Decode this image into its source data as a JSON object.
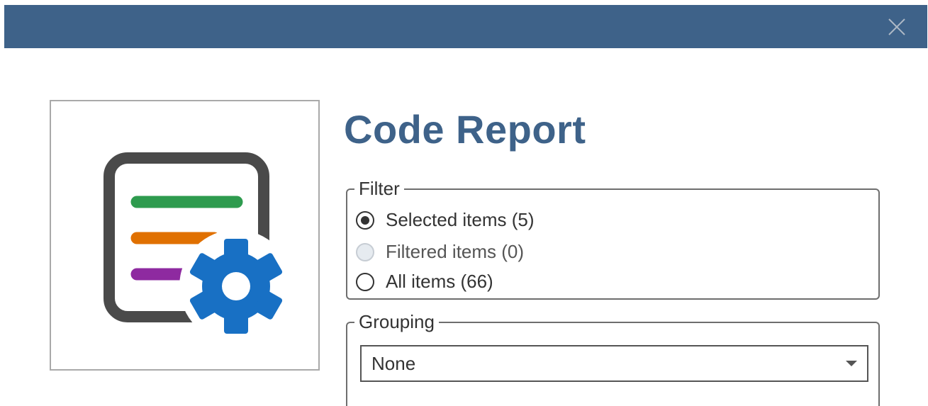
{
  "window": {
    "titlebar_color": "#3e6289",
    "close_icon": "close-icon"
  },
  "logo": {
    "icon": "report-settings-icon",
    "line_colors": [
      "#2e9b4e",
      "#e07000",
      "#8e2aa0"
    ],
    "gear_color": "#1870c4"
  },
  "header": {
    "title": "Code Report"
  },
  "filter": {
    "legend": "Filter",
    "options": [
      {
        "label": "Selected items (5)",
        "selected": true,
        "enabled": true
      },
      {
        "label": "Filtered items (0)",
        "selected": false,
        "enabled": false
      },
      {
        "label": "All items (66)",
        "selected": false,
        "enabled": true
      }
    ]
  },
  "grouping": {
    "legend": "Grouping",
    "selected_value": "None"
  }
}
